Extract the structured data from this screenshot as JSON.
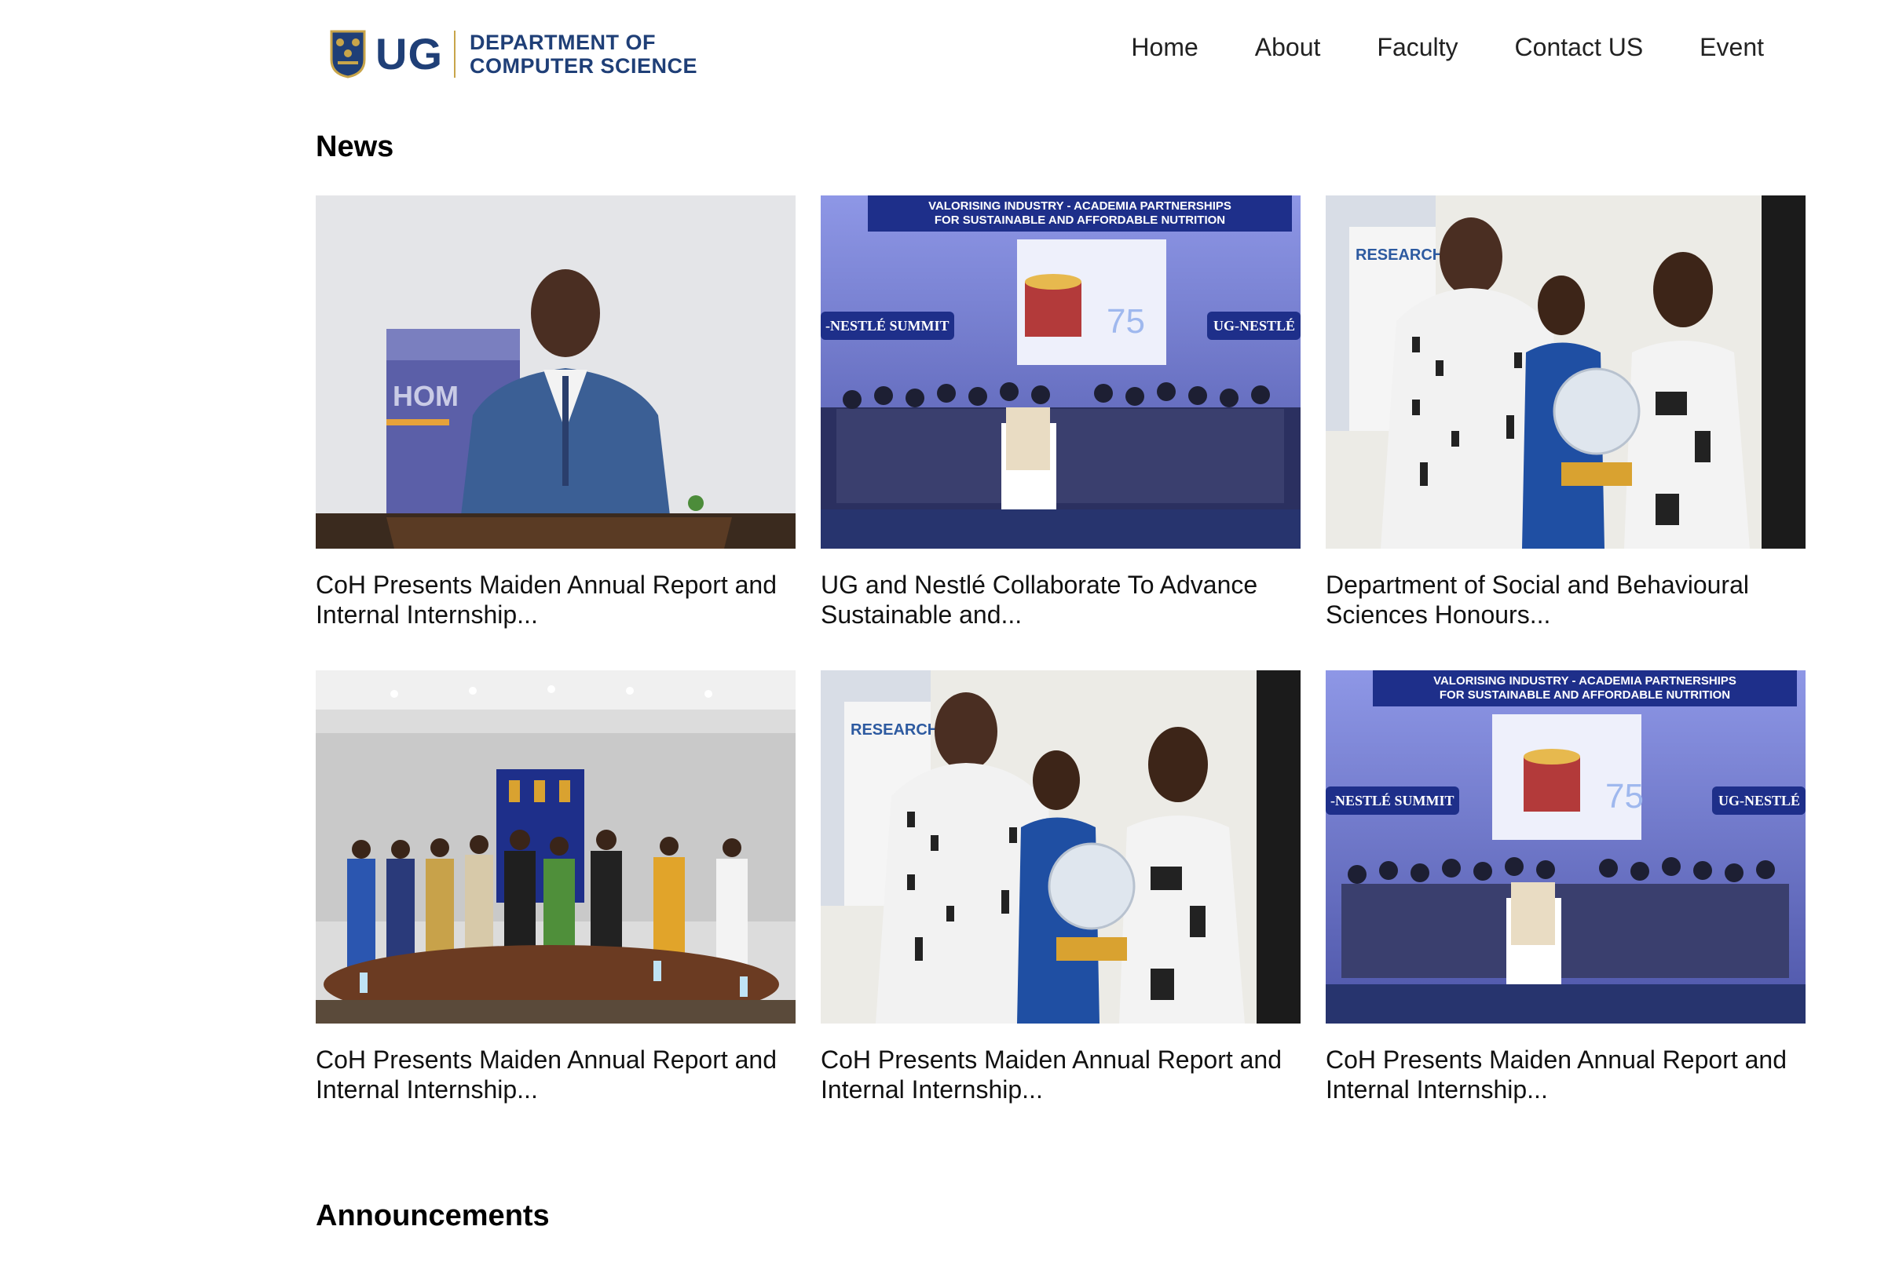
{
  "header": {
    "logo_ug": "UG",
    "logo_line1": "DEPARTMENT OF",
    "logo_line2": "COMPUTER SCIENCE",
    "nav": [
      {
        "label": "Home"
      },
      {
        "label": "About"
      },
      {
        "label": "Faculty"
      },
      {
        "label": "Contact US"
      },
      {
        "label": "Event"
      }
    ]
  },
  "news": {
    "title": "News",
    "items": [
      {
        "caption": "CoH Presents Maiden Annual Report and Internal Internship...",
        "image": "speaker-at-podium"
      },
      {
        "caption": "UG and Nestlé Collaborate To Advance Sustainable and...",
        "image": "nestle-summit-group"
      },
      {
        "caption": "Department of Social and Behavioural Sciences Honours...",
        "image": "award-presentation"
      },
      {
        "caption": "CoH Presents Maiden Annual Report and Internal Internship...",
        "image": "group-in-boardroom"
      },
      {
        "caption": "CoH Presents Maiden Annual Report and Internal Internship...",
        "image": "award-presentation"
      },
      {
        "caption": "CoH Presents Maiden Annual Report and Internal Internship...",
        "image": "nestle-summit-group"
      }
    ]
  },
  "announcements": {
    "title": "Announcements"
  },
  "images": {
    "banner_line1": "VALORISING INDUSTRY - ACADEMIA PARTNERSHIPS",
    "banner_line2": "FOR SUSTAINABLE AND AFFORDABLE NUTRITION",
    "summit_left": "-NESTLÉ SUMMIT",
    "summit_right": "UG-NESTLÉ",
    "summit_number": "75",
    "research_sign": "RESEARCH"
  },
  "colors": {
    "brand_blue": "#1f3f77",
    "brand_gold": "#c8a54a"
  }
}
